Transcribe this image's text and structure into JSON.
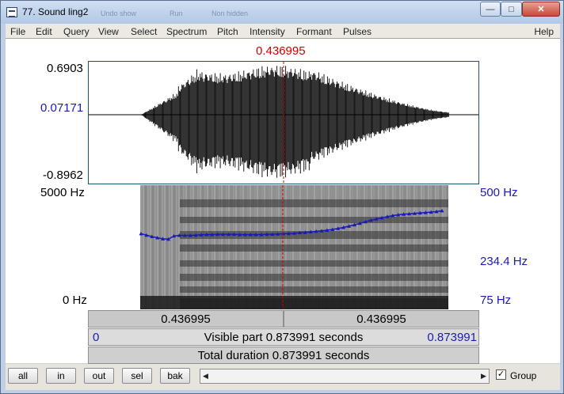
{
  "window": {
    "title": "77. Sound ling2",
    "ghost_texts": [
      "Undo show",
      "Run",
      "Non hidden"
    ],
    "min_symbol": "—",
    "max_symbol": "□",
    "close_symbol": "✕"
  },
  "menu": [
    "File",
    "Edit",
    "Query",
    "View",
    "Select",
    "Spectrum",
    "Pitch",
    "Intensity",
    "Formant",
    "Pulses"
  ],
  "help_label": "Help",
  "cursor_time": "0.436995",
  "waveform": {
    "max": "0.6903",
    "cursor_value": "0.07171",
    "min": "-0.8962"
  },
  "spectrogram": {
    "freq_top": "5000 Hz",
    "freq_bottom": "0 Hz"
  },
  "pitch_axis": {
    "top": "500 Hz",
    "mid": "234.4 Hz",
    "bottom": "75 Hz"
  },
  "pitch_contour_hz": [
    238,
    233,
    228,
    224,
    220,
    219,
    230,
    232,
    232,
    232,
    233,
    234,
    235,
    235,
    236,
    236,
    236,
    236,
    235,
    235,
    235,
    235,
    235,
    236,
    236,
    237,
    238,
    239,
    240,
    242,
    243,
    245,
    247,
    249,
    251,
    254,
    258,
    262,
    267,
    273,
    279,
    286,
    292,
    298,
    304,
    309,
    314,
    318,
    321,
    323,
    325,
    327,
    329,
    331,
    334,
    338
  ],
  "time_bars": {
    "left_segment": "0.436995",
    "right_segment": "0.436995",
    "visible_start": "0",
    "visible_text": "Visible part 0.873991 seconds",
    "visible_end": "0.873991",
    "total_text": "Total duration 0.873991 seconds"
  },
  "buttons": [
    "all",
    "in",
    "out",
    "sel",
    "bak"
  ],
  "scroll": {
    "left_arrow": "◀",
    "right_arrow": "▶"
  },
  "group": {
    "label": "Group",
    "checked": "✓"
  },
  "colors": {
    "cursor": "#d10000",
    "pitch": "#1a1ab8",
    "frame": "#15546d"
  }
}
